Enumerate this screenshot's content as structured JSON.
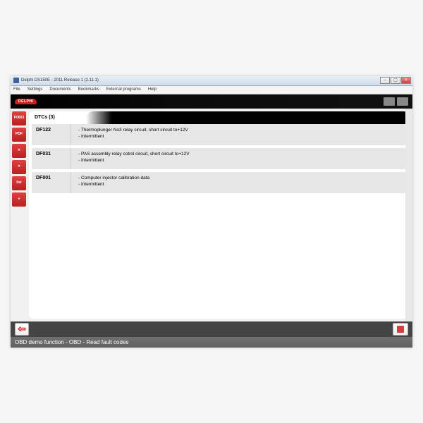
{
  "window": {
    "title": "Delphi DS150E - 2011 Release 1 (2.11.1)",
    "menu": [
      "File",
      "Settings",
      "Documents",
      "Bookmarks",
      "External programs",
      "Help"
    ]
  },
  "brand": {
    "logo": "DELPHI"
  },
  "tools": [
    {
      "name": "p0603",
      "label": "P0603"
    },
    {
      "name": "pdf",
      "label": "PDF"
    },
    {
      "name": "settings",
      "label": ""
    },
    {
      "name": "erase",
      "label": ""
    },
    {
      "name": "list",
      "label": "list"
    },
    {
      "name": "info",
      "label": ""
    }
  ],
  "dtc": {
    "header": "DTCs (3)",
    "items": [
      {
        "code": "DF122",
        "desc": "- Thermoplunger No3 relay circuit, short circuit to+12V",
        "status": "- Intermittent"
      },
      {
        "code": "DF031",
        "desc": "- PAS assembly relay cotrol circuit, short circuit to+12V",
        "status": "- Intermittent"
      },
      {
        "code": "DF001",
        "desc": "- Computer injector calibration data",
        "status": "- Intermittent"
      }
    ]
  },
  "status": {
    "text": "OBD demo function - OBD - Read fault codes"
  }
}
